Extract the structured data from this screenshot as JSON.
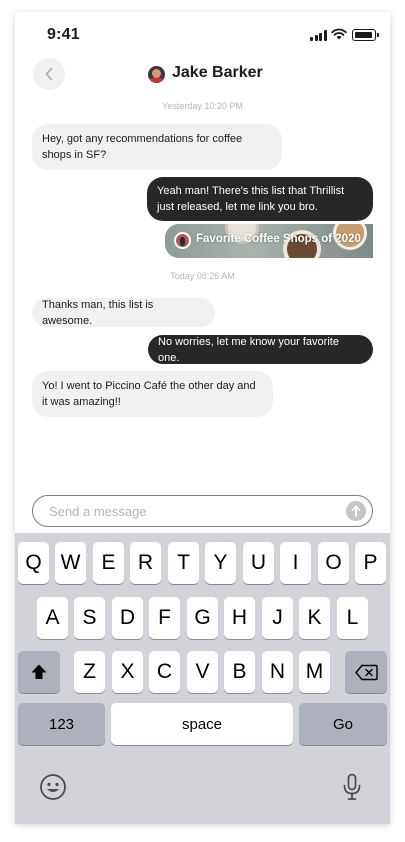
{
  "status_bar": {
    "time": "9:41"
  },
  "header": {
    "contact_name": "Jake Barker"
  },
  "conversation": {
    "timestamps": [
      "Yesterday 10:20 PM",
      "Today 08:26 AM"
    ],
    "messages": [
      {
        "direction": "in",
        "text": "Hey, got any recommendations for coffee shops in SF?"
      },
      {
        "direction": "out",
        "text": "Yeah man! There's this list that Thrillist just released, let me link you bro."
      },
      {
        "direction": "in",
        "text": "Thanks man, this list is awesome."
      },
      {
        "direction": "out",
        "text": "No worries, let me know your favorite one."
      },
      {
        "direction": "in",
        "text": "Yo! I went to Piccino Café the other day and it was amazing!!"
      }
    ],
    "link_card": {
      "title": "Favorite Coffee Shops of 2020"
    }
  },
  "composer": {
    "placeholder": "Send a message"
  },
  "keyboard": {
    "row1": [
      "Q",
      "W",
      "E",
      "R",
      "T",
      "Y",
      "U",
      "I",
      "O",
      "P"
    ],
    "row2": [
      "A",
      "S",
      "D",
      "F",
      "G",
      "H",
      "J",
      "K",
      "L"
    ],
    "row3": [
      "Z",
      "X",
      "C",
      "V",
      "B",
      "N",
      "M"
    ],
    "numbers_key": "123",
    "space_key": "space",
    "return_key": "Go"
  },
  "colors": {
    "outgoing_bubble": "#27272a",
    "incoming_bubble": "#f1f1f3",
    "keyboard_bg": "#d1d3d9",
    "special_key": "#acb1bb"
  }
}
